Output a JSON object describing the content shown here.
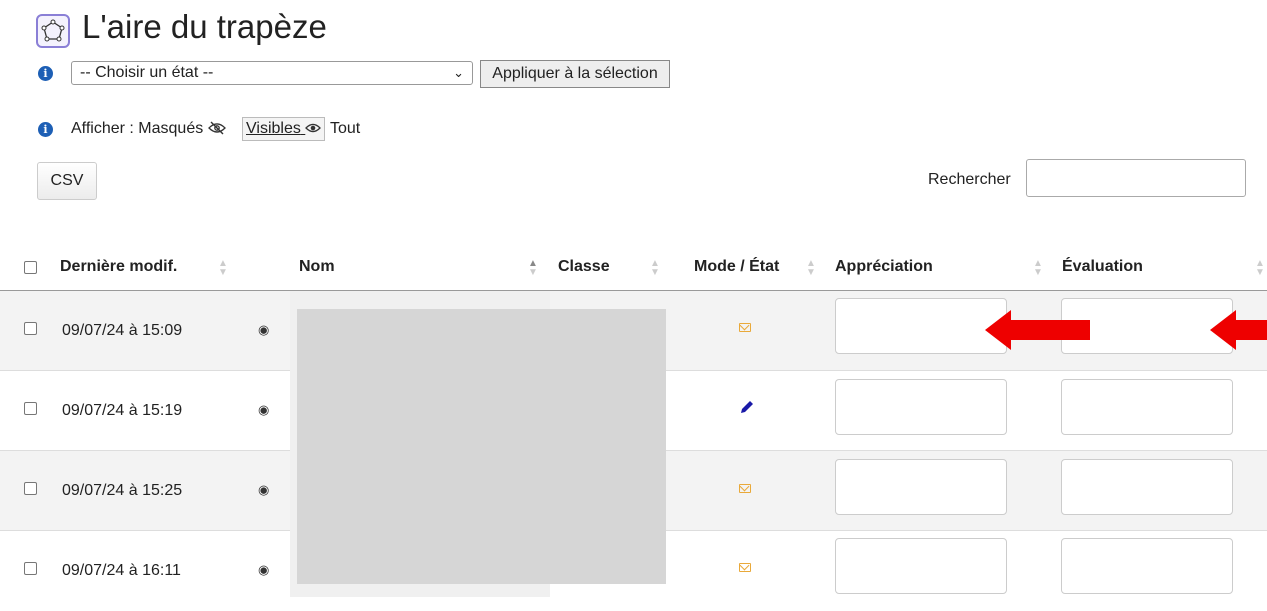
{
  "header": {
    "title": "L'aire du trapèze",
    "title_icon": "polygon-activity-icon"
  },
  "toolbar": {
    "state_select_value": "-- Choisir un état --",
    "apply_label": "Appliquer à la sélection",
    "show_label": "Afficher : Masqués",
    "visible_label": "Visibles",
    "all_label": "Tout",
    "csv_label": "CSV",
    "search_label": "Rechercher",
    "search_value": ""
  },
  "table": {
    "columns": [
      "Dernière modif.",
      "Nom",
      "Classe",
      "Mode / État",
      "Appréciation",
      "Évaluation"
    ],
    "rows": [
      {
        "date": "09/07/24 à 15:09",
        "mode_icon": "envelope-icon",
        "appreciation": "",
        "evaluation": ""
      },
      {
        "date": "09/07/24 à 15:19",
        "mode_icon": "pencil-icon",
        "appreciation": "",
        "evaluation": ""
      },
      {
        "date": "09/07/24 à 15:25",
        "mode_icon": "envelope-icon",
        "appreciation": "",
        "evaluation": ""
      },
      {
        "date": "09/07/24 à 16:11",
        "mode_icon": "envelope-icon",
        "appreciation": "",
        "evaluation": ""
      }
    ]
  },
  "colors": {
    "annotation_arrow": "#ee0000",
    "envelope": "#e9a93a",
    "pencil": "#1a1aa8",
    "info": "#1d5fb5"
  }
}
